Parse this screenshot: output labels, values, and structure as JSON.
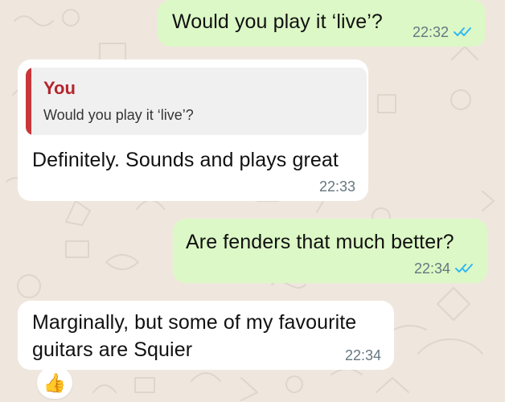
{
  "chat": {
    "messages": [
      {
        "direction": "outgoing",
        "text": "Would you play it ‘live’?",
        "time": "22:32",
        "status": "read"
      },
      {
        "direction": "incoming",
        "reply": {
          "sender": "You",
          "text": "Would you play it ‘live’?"
        },
        "text": "Definitely. Sounds and plays great",
        "time": "22:33"
      },
      {
        "direction": "outgoing",
        "text": "Are fenders that much better?",
        "time": "22:34",
        "status": "read"
      },
      {
        "direction": "incoming",
        "text_lines": [
          "Marginally, but some of my favourite",
          "guitars are Squier"
        ],
        "time": "22:34",
        "reaction": {
          "icon": "thumbs-up-icon",
          "glyph": "👍"
        }
      }
    ]
  },
  "theme": {
    "background": "#efe7de",
    "outgoing_bubble": "#dcf8c6",
    "incoming_bubble": "#ffffff",
    "reply_accent": "#c8363a",
    "read_receipt": "#34b7f1",
    "meta_text": "#667781"
  }
}
